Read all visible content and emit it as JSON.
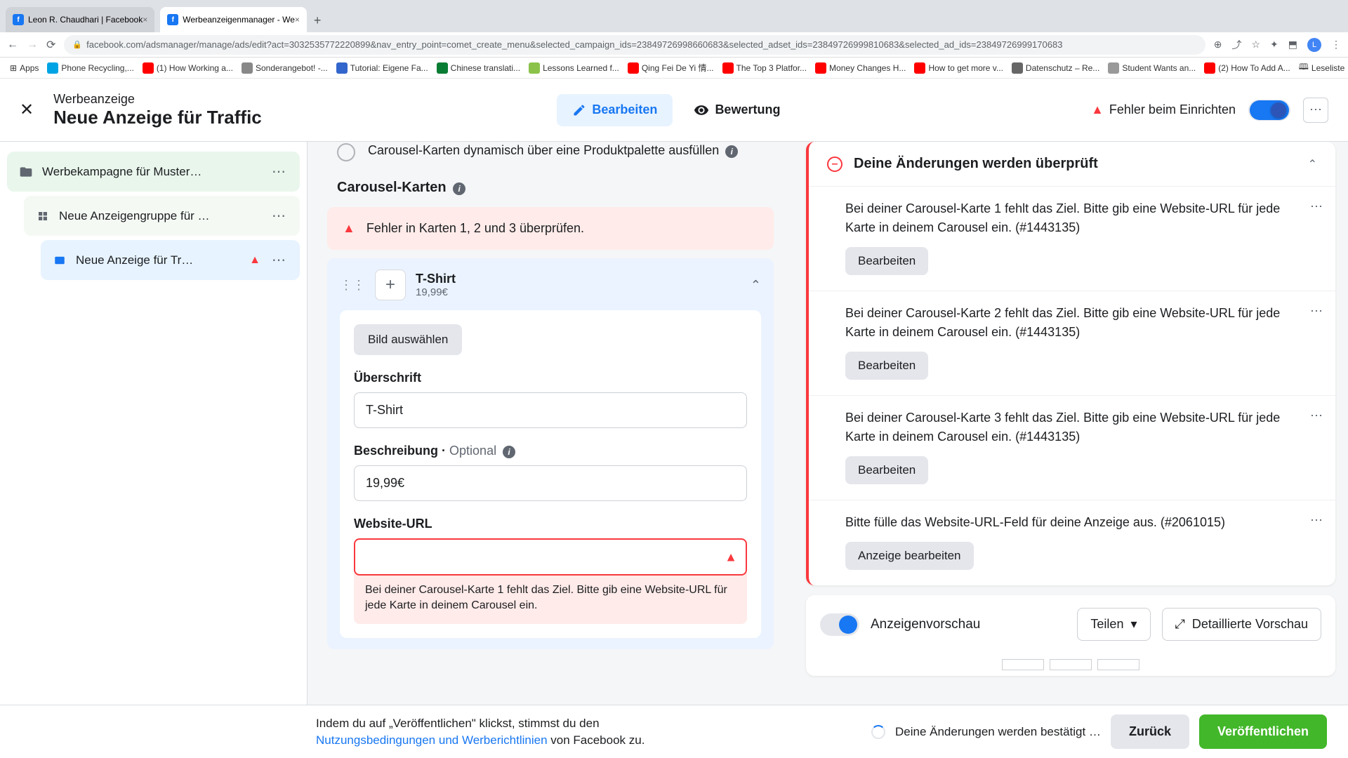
{
  "browser": {
    "tabs": [
      {
        "title": "Leon R. Chaudhari | Facebook"
      },
      {
        "title": "Werbeanzeigenmanager - We"
      }
    ],
    "url": "facebook.com/adsmanager/manage/ads/edit?act=3032535772220899&nav_entry_point=comet_create_menu&selected_campaign_ids=23849726998660683&selected_adset_ids=23849726999810683&selected_ad_ids=23849726999170683",
    "bookmarks": [
      "Apps",
      "Phone Recycling,...",
      "(1) How Working a...",
      "Sonderangebot! -...",
      "Tutorial: Eigene Fa...",
      "Chinese translati...",
      "Lessons Learned f...",
      "Qing Fei De Yi 情...",
      "The Top 3 Platfor...",
      "Money Changes H...",
      "How to get more v...",
      "Datenschutz – Re...",
      "Student Wants an...",
      "(2) How To Add A..."
    ],
    "reading_list": "Leseliste"
  },
  "header": {
    "subtitle": "Werbeanzeige",
    "title": "Neue Anzeige für Traffic",
    "edit": "Bearbeiten",
    "review": "Bewertung",
    "error_status": "Fehler beim Einrichten"
  },
  "sidebar": {
    "campaign": "Werbekampagne für Muster…",
    "adset": "Neue Anzeigengruppe für …",
    "ad": "Neue Anzeige für Tr…"
  },
  "center": {
    "dynamic_checkbox": "Carousel-Karten dynamisch über eine Produktpalette ausfüllen",
    "section": "Carousel-Karten",
    "error_banner": "Fehler in Karten 1, 2 und 3 überprüfen.",
    "card": {
      "title": "T-Shirt",
      "price": "19,99€",
      "select_image": "Bild auswählen",
      "headline_label": "Überschrift",
      "headline_value": "T-Shirt",
      "description_label": "Beschreibung",
      "optional": "Optional",
      "description_value": "19,99€",
      "url_label": "Website-URL",
      "url_error": "Bei deiner Carousel-Karte 1 fehlt das Ziel. Bitte gib eine Website-URL für jede Karte in deinem Carousel ein."
    }
  },
  "review": {
    "title": "Deine Änderungen werden überprüft",
    "items": [
      {
        "text": "Bei deiner Carousel-Karte 1 fehlt das Ziel. Bitte gib eine Website-URL für jede Karte in deinem Carousel ein. (#1443135)",
        "btn": "Bearbeiten"
      },
      {
        "text": "Bei deiner Carousel-Karte 2 fehlt das Ziel. Bitte gib eine Website-URL für jede Karte in deinem Carousel ein. (#1443135)",
        "btn": "Bearbeiten"
      },
      {
        "text": "Bei deiner Carousel-Karte 3 fehlt das Ziel. Bitte gib eine Website-URL für jede Karte in deinem Carousel ein. (#1443135)",
        "btn": "Bearbeiten"
      },
      {
        "text": "Bitte fülle das Website-URL-Feld für deine Anzeige aus. (#2061015)",
        "btn": "Anzeige bearbeiten"
      }
    ]
  },
  "preview": {
    "label": "Anzeigenvorschau",
    "share": "Teilen",
    "detailed": "Detaillierte Vorschau"
  },
  "footer": {
    "text1": "Indem du auf „Veröffentlichen\" klickst, stimmst du den",
    "link": "Nutzungsbedingungen und Werberichtlinien",
    "text2": " von Facebook zu.",
    "confirming": "Deine Änderungen werden bestätigt …",
    "back": "Zurück",
    "publish": "Veröffentlichen"
  }
}
